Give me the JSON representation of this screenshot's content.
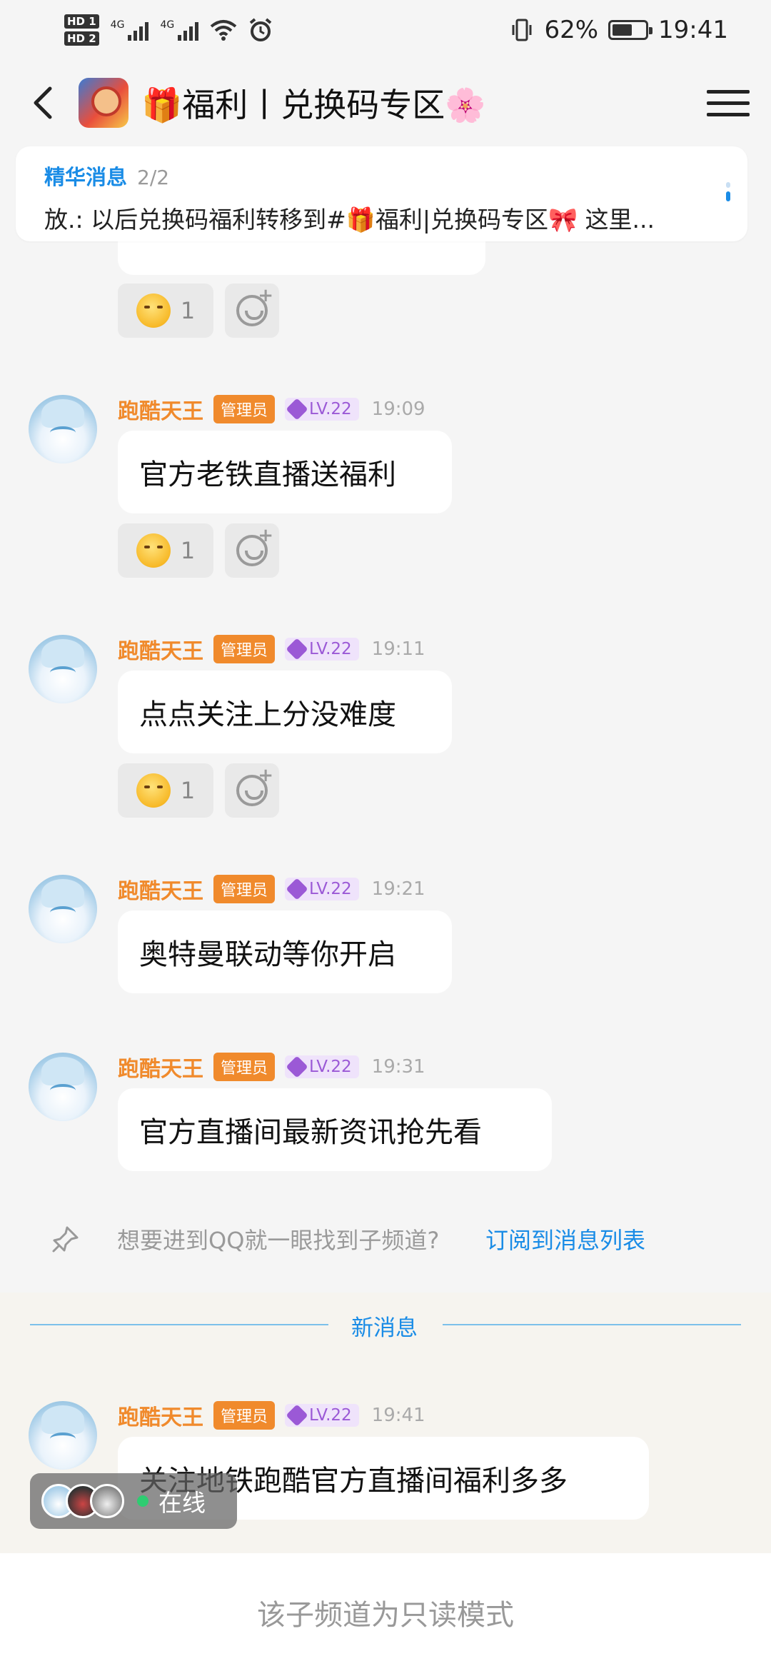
{
  "status_bar": {
    "hd1": "HD 1",
    "hd2": "HD 2",
    "net1": "4G",
    "net2": "4G",
    "battery_percent": "62%",
    "battery_level": 0.62,
    "time": "19:41"
  },
  "header": {
    "title": "🎁福利丨兑换码专区🌸"
  },
  "pinned": {
    "label": "精华消息",
    "count": "2/2",
    "text": "放.: 以后兑换码福利转移到#🎁福利|兑换码专区🎀 这里..."
  },
  "messages": [
    {
      "name": "跑酷天王",
      "role": "管理员",
      "level": "LV.22",
      "time": "19:09",
      "text": "官方老铁直播送福利",
      "reaction_count": "1"
    },
    {
      "name": "跑酷天王",
      "role": "管理员",
      "level": "LV.22",
      "time": "19:11",
      "text": "点点关注上分没难度",
      "reaction_count": "1"
    },
    {
      "name": "跑酷天王",
      "role": "管理员",
      "level": "LV.22",
      "time": "19:21",
      "text": "奥特曼联动等你开启"
    },
    {
      "name": "跑酷天王",
      "role": "管理员",
      "level": "LV.22",
      "time": "19:31",
      "text": "官方直播间最新资讯抢先看"
    },
    {
      "name": "跑酷天王",
      "role": "管理员",
      "level": "LV.22",
      "time": "19:41",
      "text": "关注地铁跑酷官方直播间福利多多"
    }
  ],
  "top_reaction_count": "1",
  "subscribe": {
    "text": "想要进到QQ就一眼找到子频道?",
    "link": "订阅到消息列表"
  },
  "new_divider": "新消息",
  "online": "在线",
  "footer": "该子频道为只读模式"
}
